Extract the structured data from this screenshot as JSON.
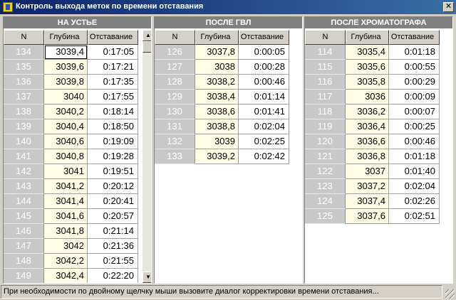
{
  "window": {
    "title": "Контроль выхода меток по времени отставания",
    "close_label": "✕"
  },
  "columns": {
    "n": "N",
    "depth": "Глубина",
    "lag": "Отставание"
  },
  "panels": [
    {
      "title": "НА УСТЬЕ",
      "rows": [
        {
          "n": "134",
          "depth": "3039,4",
          "lag": "0:17:05"
        },
        {
          "n": "135",
          "depth": "3039,6",
          "lag": "0:17:21"
        },
        {
          "n": "136",
          "depth": "3039,8",
          "lag": "0:17:35"
        },
        {
          "n": "137",
          "depth": "3040",
          "lag": "0:17:55"
        },
        {
          "n": "138",
          "depth": "3040,2",
          "lag": "0:18:14"
        },
        {
          "n": "139",
          "depth": "3040,4",
          "lag": "0:18:50"
        },
        {
          "n": "140",
          "depth": "3040,6",
          "lag": "0:19:09"
        },
        {
          "n": "141",
          "depth": "3040,8",
          "lag": "0:19:28"
        },
        {
          "n": "142",
          "depth": "3041",
          "lag": "0:19:51"
        },
        {
          "n": "143",
          "depth": "3041,2",
          "lag": "0:20:12"
        },
        {
          "n": "144",
          "depth": "3041,4",
          "lag": "0:20:41"
        },
        {
          "n": "145",
          "depth": "3041,6",
          "lag": "0:20:57"
        },
        {
          "n": "146",
          "depth": "3041,8",
          "lag": "0:21:14"
        },
        {
          "n": "147",
          "depth": "3042",
          "lag": "0:21:36"
        },
        {
          "n": "148",
          "depth": "3042,2",
          "lag": "0:21:55"
        },
        {
          "n": "149",
          "depth": "3042,4",
          "lag": "0:22:20"
        }
      ]
    },
    {
      "title": "ПОСЛЕ ГВЛ",
      "rows": [
        {
          "n": "126",
          "depth": "3037,8",
          "lag": "0:00:05"
        },
        {
          "n": "127",
          "depth": "3038",
          "lag": "0:00:28"
        },
        {
          "n": "128",
          "depth": "3038,2",
          "lag": "0:00:46"
        },
        {
          "n": "129",
          "depth": "3038,4",
          "lag": "0:01:14"
        },
        {
          "n": "130",
          "depth": "3038,6",
          "lag": "0:01:41"
        },
        {
          "n": "131",
          "depth": "3038,8",
          "lag": "0:02:04"
        },
        {
          "n": "132",
          "depth": "3039",
          "lag": "0:02:25"
        },
        {
          "n": "133",
          "depth": "3039,2",
          "lag": "0:02:42"
        }
      ]
    },
    {
      "title": "ПОСЛЕ ХРОМАТОГРАФА",
      "rows": [
        {
          "n": "114",
          "depth": "3035,4",
          "lag": "0:01:18"
        },
        {
          "n": "115",
          "depth": "3035,6",
          "lag": "0:00:55"
        },
        {
          "n": "116",
          "depth": "3035,8",
          "lag": "0:00:29"
        },
        {
          "n": "117",
          "depth": "3036",
          "lag": "0:00:09"
        },
        {
          "n": "118",
          "depth": "3036,2",
          "lag": "0:00:07"
        },
        {
          "n": "119",
          "depth": "3036,4",
          "lag": "0:00:25"
        },
        {
          "n": "120",
          "depth": "3036,6",
          "lag": "0:00:46"
        },
        {
          "n": "121",
          "depth": "3036,8",
          "lag": "0:01:18"
        },
        {
          "n": "122",
          "depth": "3037",
          "lag": "0:01:40"
        },
        {
          "n": "123",
          "depth": "3037,2",
          "lag": "0:02:04"
        },
        {
          "n": "124",
          "depth": "3037,4",
          "lag": "0:02:26"
        },
        {
          "n": "125",
          "depth": "3037,6",
          "lag": "0:02:51"
        }
      ]
    }
  ],
  "statusbar": {
    "text": "При необходимости по двойному щелчку мыши вызовите диалог корректировки времени отставания..."
  }
}
